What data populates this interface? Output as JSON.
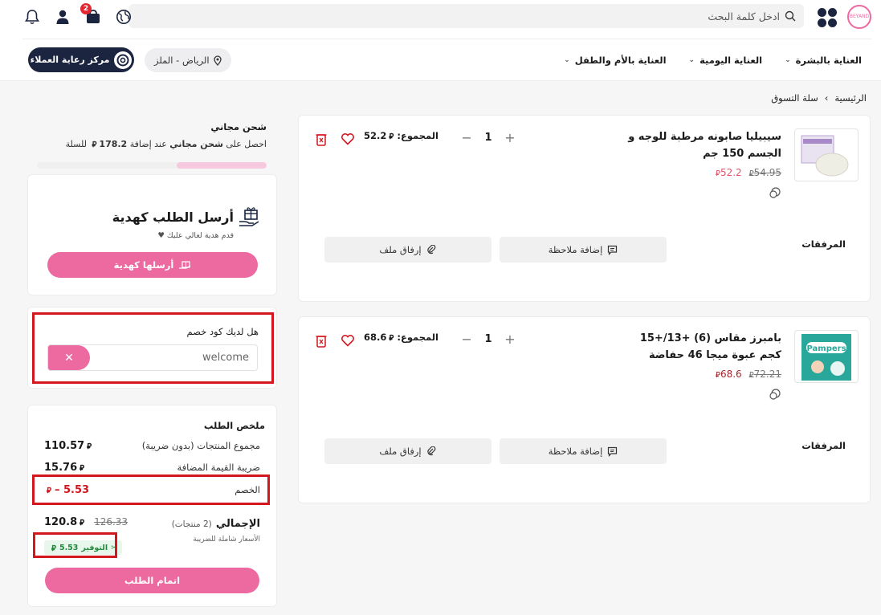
{
  "header": {
    "logo_text": "BEYAND",
    "search_placeholder": "ادخل كلمة البحث",
    "cart_count": "2",
    "nav": [
      {
        "label": "العناية بالبشرة"
      },
      {
        "label": "العناية اليومية"
      },
      {
        "label": "العناية بالأم والطفل"
      }
    ],
    "location": "الرياض - الملز",
    "care_center": "مركز رعاية العملاء"
  },
  "breadcrumb": {
    "home": "الرئيسية",
    "sep": "›",
    "current": "سلة التسوق"
  },
  "currency": "⃁",
  "products": [
    {
      "title": "سيبيليا صابونه مرطبة للوجه و الجسم 150 جم",
      "old_price": "54.95",
      "new_price": "52.2",
      "qty": "1",
      "total_label": "المجموع:",
      "total_value": "52.2",
      "attachments_label": "المرفقات",
      "note_btn": "إضافة ملاحظة",
      "file_btn": "إرفاق ملف"
    },
    {
      "title": "بامبرز مقاس (6) +13/+15 كجم عبوة ميجا 46 حفاضة",
      "old_price": "72.21",
      "new_price": "68.6",
      "qty": "1",
      "total_label": "المجموع:",
      "total_value": "68.6",
      "attachments_label": "المرفقات",
      "note_btn": "إضافة ملاحظة",
      "file_btn": "إرفاق ملف",
      "brand": "Pampers"
    }
  ],
  "free_shipping": {
    "title": "شحن مجاني",
    "sub_pre": "احصل على",
    "sub_bold": "شحن مجاني",
    "sub_mid": "عند إضافة",
    "amount": "178.2",
    "sub_post": "للسلة",
    "progress": 0.39
  },
  "gift": {
    "title": "أرسل الطلب كهدية",
    "sub": "قدم هدية لغالي عليك ♥",
    "button": "أرسلها كهدية"
  },
  "coupon": {
    "label": "هل لديك كود خصم",
    "value": "welcome",
    "clear": "✕"
  },
  "summary": {
    "title": "ملخص الطلب",
    "subtotal_label": "مجموع المنتجات (بدون ضريبة)",
    "subtotal": "110.57",
    "vat_label": "ضريبة القيمة المضافة",
    "vat": "15.76",
    "discount_label": "الخصم",
    "discount": "5.53 –",
    "total_label": "الإجمالي",
    "total_count": "(2 منتجات)",
    "total_old": "126.33",
    "total": "120.8",
    "tax_note": "الأسعار شاملة للضريبة",
    "saving_label": "التوفير",
    "saving": "5.53",
    "checkout": "اتمام الطلب"
  }
}
